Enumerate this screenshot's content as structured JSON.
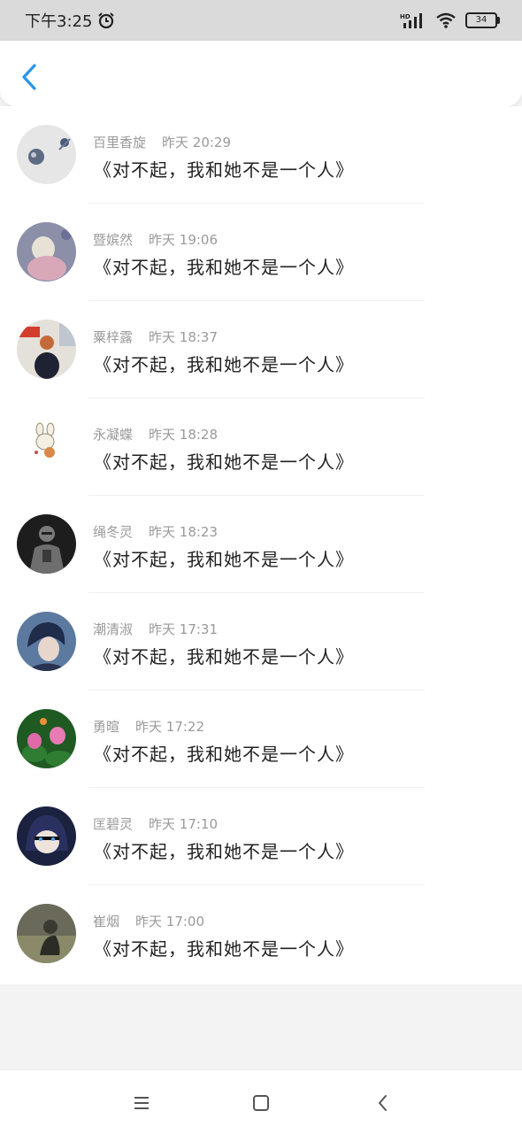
{
  "status_bar": {
    "time": "下午3:25",
    "network": "HD",
    "battery": "34",
    "icons": [
      "alarm-icon",
      "signal-icon",
      "wifi-icon",
      "battery-icon"
    ]
  },
  "header": {
    "back_icon": "chevron-left-icon",
    "accent_color": "#2b95e9"
  },
  "comments": [
    {
      "name": "百里香旋",
      "time": "昨天 20:29",
      "text": "《对不起，我和她不是一个人》"
    },
    {
      "name": "暨嫔然",
      "time": "昨天 19:06",
      "text": "《对不起，我和她不是一个人》"
    },
    {
      "name": "粟梓露",
      "time": "昨天 18:37",
      "text": "《对不起，我和她不是一个人》"
    },
    {
      "name": "永凝蝶",
      "time": "昨天 18:28",
      "text": "《对不起，我和她不是一个人》"
    },
    {
      "name": "绳冬灵",
      "time": "昨天 18:23",
      "text": "《对不起，我和她不是一个人》"
    },
    {
      "name": "潮清淑",
      "time": "昨天 17:31",
      "text": "《对不起，我和她不是一个人》"
    },
    {
      "name": "勇暄",
      "time": "昨天 17:22",
      "text": "《对不起，我和她不是一个人》"
    },
    {
      "name": "匡碧灵",
      "time": "昨天 17:10",
      "text": "《对不起，我和她不是一个人》"
    },
    {
      "name": "崔烟",
      "time": "昨天 17:00",
      "text": "《对不起，我和她不是一个人》"
    }
  ],
  "nav_bar": {
    "icons": [
      "menu-icon",
      "home-icon",
      "back-icon"
    ]
  }
}
